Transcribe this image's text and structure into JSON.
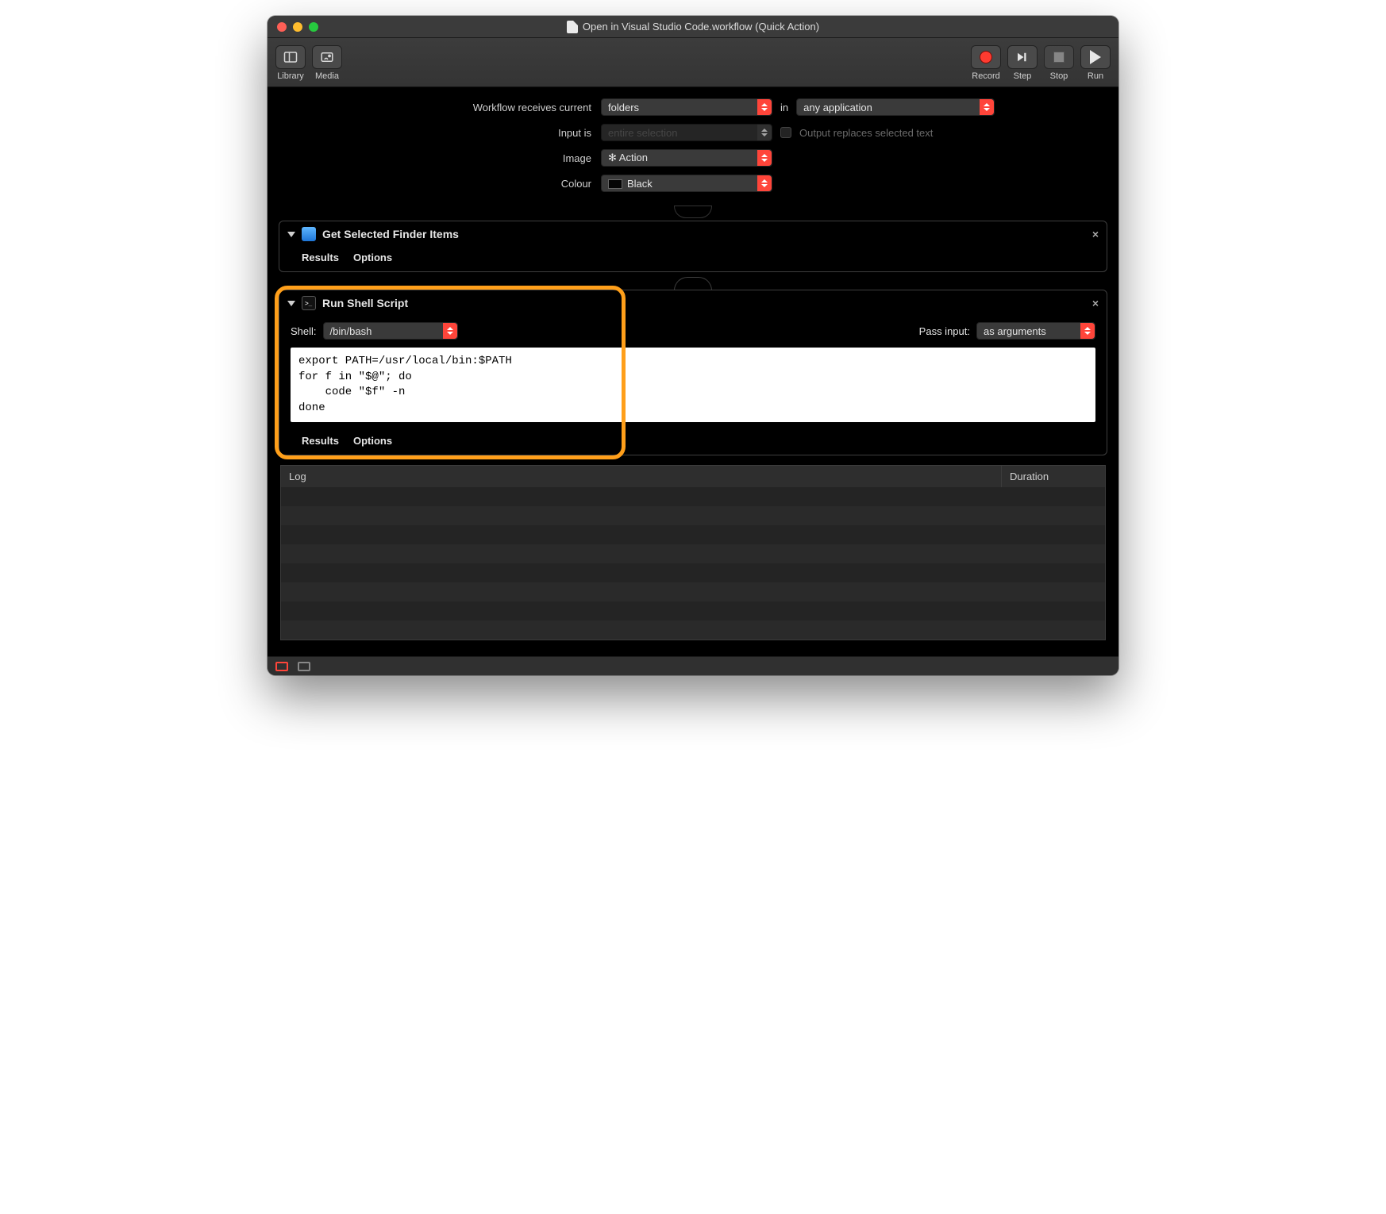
{
  "window": {
    "title": "Open in Visual Studio Code.workflow (Quick Action)"
  },
  "toolbar": {
    "library": "Library",
    "media": "Media",
    "record": "Record",
    "step": "Step",
    "stop": "Stop",
    "run": "Run"
  },
  "config": {
    "receives_label": "Workflow receives current",
    "receives_value": "folders",
    "in_label": "in",
    "in_value": "any application",
    "input_is_label": "Input is",
    "input_is_value": "entire selection",
    "output_replaces_label": "Output replaces selected text",
    "image_label": "Image",
    "image_value": "✻ Action",
    "colour_label": "Colour",
    "colour_value": "Black"
  },
  "actions": [
    {
      "title": "Get Selected Finder Items",
      "tabs": {
        "results": "Results",
        "options": "Options"
      }
    },
    {
      "title": "Run Shell Script",
      "shell_label": "Shell:",
      "shell_value": "/bin/bash",
      "pass_input_label": "Pass input:",
      "pass_input_value": "as arguments",
      "script": "export PATH=/usr/local/bin:$PATH\nfor f in \"$@\"; do\n    code \"$f\" -n\ndone",
      "tabs": {
        "results": "Results",
        "options": "Options"
      }
    }
  ],
  "log": {
    "col_log": "Log",
    "col_duration": "Duration"
  }
}
